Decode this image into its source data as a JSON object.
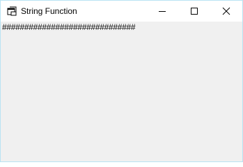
{
  "window": {
    "title": "String Function",
    "icons": {
      "app": "form-icon",
      "minimize": "minimize-icon",
      "maximize": "maximize-icon",
      "close": "close-icon"
    }
  },
  "client": {
    "output_text": "##############################"
  },
  "colors": {
    "titlebar_bg": "#ffffff",
    "client_bg": "#f0f0f0",
    "window_border": "#b9e3f3",
    "text": "#000000"
  }
}
